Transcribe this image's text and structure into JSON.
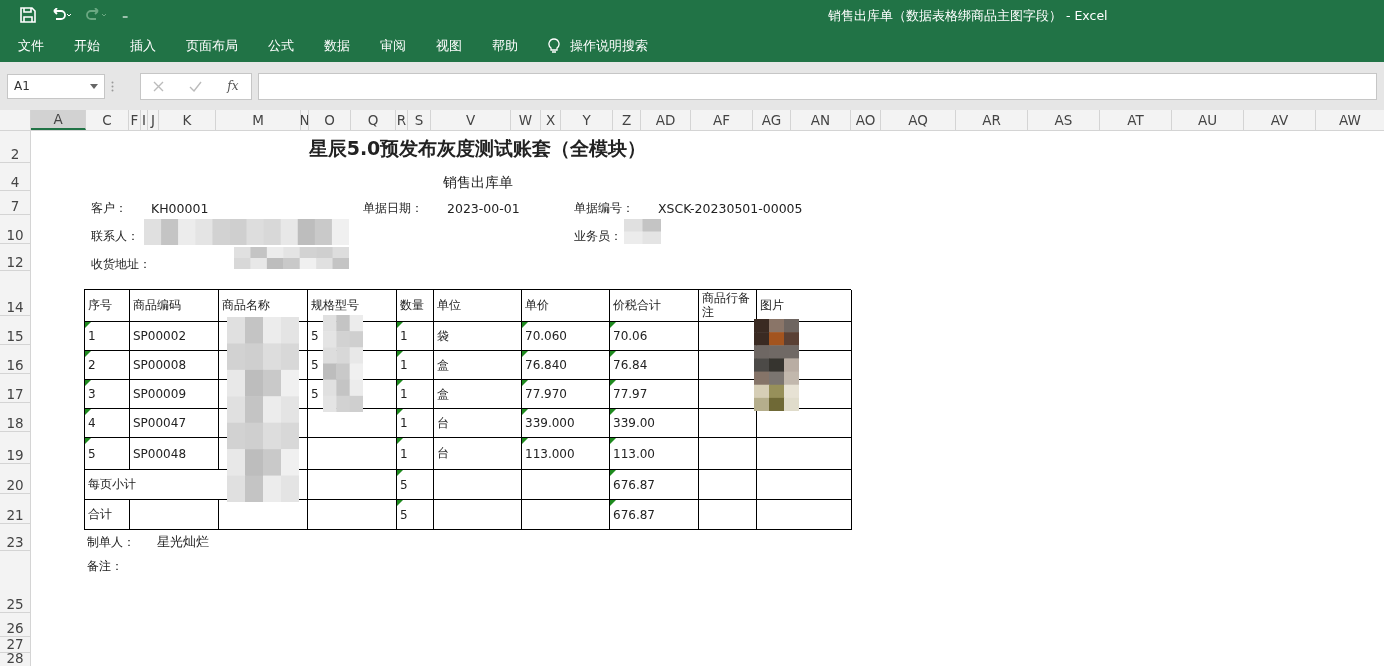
{
  "window": {
    "title": "销售出库单（数据表格绑商品主图字段）  -  Excel"
  },
  "quick_access": {
    "customize": "₌"
  },
  "menu": [
    {
      "label": "文件"
    },
    {
      "label": "开始"
    },
    {
      "label": "插入"
    },
    {
      "label": "页面布局"
    },
    {
      "label": "公式"
    },
    {
      "label": "数据"
    },
    {
      "label": "审阅"
    },
    {
      "label": "视图"
    },
    {
      "label": "帮助"
    }
  ],
  "tell_me": {
    "label": "操作说明搜索"
  },
  "formula_bar": {
    "name_box": "A1",
    "fx": "fx"
  },
  "column_headers": [
    {
      "label": "A",
      "selected": true
    },
    {
      "label": "C",
      "selected": false
    },
    {
      "label": "F",
      "selected": false
    },
    {
      "label": "I",
      "selected": false
    },
    {
      "label": "J",
      "selected": false
    },
    {
      "label": "K",
      "selected": false
    },
    {
      "label": "M",
      "selected": false
    },
    {
      "label": "N",
      "selected": false
    },
    {
      "label": "O",
      "selected": false
    },
    {
      "label": "Q",
      "selected": false
    },
    {
      "label": "R",
      "selected": false
    },
    {
      "label": "S",
      "selected": false
    },
    {
      "label": "V",
      "selected": false
    },
    {
      "label": "W",
      "selected": false
    },
    {
      "label": "X",
      "selected": false
    },
    {
      "label": "Y",
      "selected": false
    },
    {
      "label": "Z",
      "selected": false
    },
    {
      "label": "AD",
      "selected": false
    },
    {
      "label": "AF",
      "selected": false
    },
    {
      "label": "AG",
      "selected": false
    },
    {
      "label": "AN",
      "selected": false
    },
    {
      "label": "AO",
      "selected": false
    },
    {
      "label": "AQ",
      "selected": false
    },
    {
      "label": "AR",
      "selected": false
    },
    {
      "label": "AS",
      "selected": false
    },
    {
      "label": "AT",
      "selected": false
    },
    {
      "label": "AU",
      "selected": false
    },
    {
      "label": "AV",
      "selected": false
    },
    {
      "label": "AW",
      "selected": false
    }
  ],
  "row_headers": [
    "2",
    "4",
    "7",
    "10",
    "12",
    "14",
    "15",
    "16",
    "17",
    "18",
    "19",
    "20",
    "21",
    "23",
    "25",
    "26",
    "27",
    "28"
  ],
  "sheet": {
    "title": "星辰5.0预发布灰度测试账套（全模块）",
    "subtitle": "销售出库单",
    "field_rows": [
      {
        "left": {
          "label": "客户：",
          "value": "KH00001"
        },
        "middle": {
          "label": "单据日期：",
          "value": "2023-00-01"
        },
        "right": {
          "label": "单据编号：",
          "value": "XSCK-20230501-00005"
        }
      },
      {
        "left": {
          "label": "联系人："
        },
        "right": {
          "label": "业务员："
        }
      },
      {
        "left": {
          "label": "收货地址："
        }
      }
    ],
    "table": {
      "columns": [
        "序号",
        "商品编码",
        "商品名称",
        "规格型号",
        "数量",
        "单位",
        "单价",
        "价税合计",
        "商品行备注",
        "图片"
      ],
      "rows": [
        {
          "kind": "item",
          "cells": [
            {
              "text": "1",
              "flagged": true
            },
            {
              "text": "SP00002"
            },
            {},
            {
              "text": "5"
            },
            {
              "text": "1",
              "flagged": true
            },
            {
              "text": "袋"
            },
            {
              "text": "70.060",
              "flagged": true
            },
            {
              "text": "70.06",
              "flagged": true
            },
            {},
            {}
          ]
        },
        {
          "kind": "item",
          "cells": [
            {
              "text": "2",
              "flagged": true
            },
            {
              "text": "SP00008"
            },
            {},
            {
              "text": "5"
            },
            {
              "text": "1",
              "flagged": true
            },
            {
              "text": "盒"
            },
            {
              "text": "76.840",
              "flagged": true
            },
            {
              "text": "76.84",
              "flagged": true
            },
            {},
            {}
          ]
        },
        {
          "kind": "item",
          "cells": [
            {
              "text": "3",
              "flagged": true
            },
            {
              "text": "SP00009"
            },
            {},
            {
              "text": "5"
            },
            {
              "text": "1",
              "flagged": true
            },
            {
              "text": "盒"
            },
            {
              "text": "77.970",
              "flagged": true
            },
            {
              "text": "77.97",
              "flagged": true
            },
            {},
            {}
          ]
        },
        {
          "kind": "item",
          "cells": [
            {
              "text": "4",
              "flagged": true
            },
            {
              "text": "SP00047"
            },
            {},
            {},
            {
              "text": "1",
              "flagged": true
            },
            {
              "text": "台"
            },
            {
              "text": "339.000",
              "flagged": true
            },
            {
              "text": "339.00",
              "flagged": true
            },
            {},
            {}
          ]
        },
        {
          "kind": "item",
          "cells": [
            {
              "text": "5",
              "flagged": true
            },
            {
              "text": "SP00048"
            },
            {},
            {},
            {
              "text": "1",
              "flagged": true
            },
            {
              "text": "台"
            },
            {
              "text": "113.000",
              "flagged": true
            },
            {
              "text": "113.00",
              "flagged": true
            },
            {},
            {}
          ]
        },
        {
          "kind": "merged",
          "cells": [
            {
              "text": "每页小计"
            },
            {},
            {},
            {},
            {
              "text": "5",
              "flagged": true
            },
            {},
            {},
            {
              "text": "676.87",
              "flagged": true
            },
            {},
            {}
          ]
        },
        {
          "kind": "plain",
          "cells": [
            {
              "text": "合计"
            },
            {},
            {},
            {},
            {
              "text": "5",
              "flagged": true
            },
            {},
            {},
            {
              "text": "676.87",
              "flagged": true
            },
            {},
            {}
          ]
        }
      ]
    },
    "maker": {
      "label": "制单人：",
      "value": "星光灿烂"
    },
    "remark": {
      "label": "备注："
    }
  }
}
